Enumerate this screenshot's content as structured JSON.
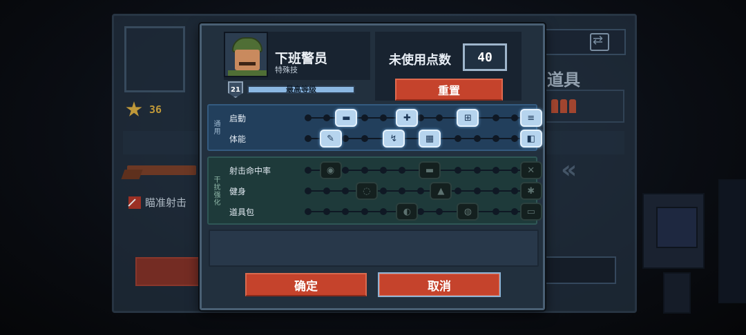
{
  "hero": {
    "name": "下班警员",
    "subtitle": "特殊技",
    "level": "21",
    "level_label": "最高等级"
  },
  "points": {
    "label": "未使用点数",
    "value": "40",
    "reset_label": "重置"
  },
  "groups": [
    {
      "tab": "通用",
      "rows": [
        {
          "label": "启動",
          "nodes": [
            {
              "pos": 0.17,
              "icon": "▬",
              "name": "ammo-clip-icon",
              "state": "active"
            },
            {
              "pos": 0.44,
              "icon": "✚",
              "name": "shield-plus-icon",
              "state": "active"
            },
            {
              "pos": 0.71,
              "icon": "⊞",
              "name": "medkit-icon",
              "state": "active"
            },
            {
              "pos": 0.99,
              "icon": "≡",
              "name": "crate-icon",
              "state": "active"
            }
          ]
        },
        {
          "label": "体能",
          "nodes": [
            {
              "pos": 0.1,
              "icon": "✎",
              "name": "knife-icon",
              "state": "active"
            },
            {
              "pos": 0.38,
              "icon": "↯",
              "name": "sprint-icon",
              "state": "active"
            },
            {
              "pos": 0.54,
              "icon": "▦",
              "name": "armor-icon",
              "state": "active"
            },
            {
              "pos": 0.99,
              "icon": "◧",
              "name": "flask-icon",
              "state": "active"
            }
          ]
        }
      ]
    },
    {
      "tab": "干扰强化",
      "rows": [
        {
          "label": "射击命中率",
          "nodes": [
            {
              "pos": 0.1,
              "icon": "◉",
              "name": "bullet-icon",
              "state": "locked"
            },
            {
              "pos": 0.54,
              "icon": "▬",
              "name": "rifle-icon",
              "state": "locked"
            },
            {
              "pos": 0.99,
              "icon": "✕",
              "name": "crosshair-icon",
              "state": "locked"
            }
          ]
        },
        {
          "label": "健身",
          "nodes": [
            {
              "pos": 0.26,
              "icon": "◌",
              "name": "fist-icon",
              "state": "locked"
            },
            {
              "pos": 0.59,
              "icon": "▲",
              "name": "dash-icon",
              "state": "locked"
            },
            {
              "pos": 0.99,
              "icon": "✱",
              "name": "strength-icon",
              "state": "locked"
            }
          ]
        },
        {
          "label": "道具包",
          "nodes": [
            {
              "pos": 0.44,
              "icon": "◐",
              "name": "bag-icon",
              "state": "locked"
            },
            {
              "pos": 0.71,
              "icon": "◍",
              "name": "grenade-icon",
              "state": "locked"
            },
            {
              "pos": 0.99,
              "icon": "▭",
              "name": "battery-icon",
              "state": "locked"
            }
          ]
        }
      ]
    }
  ],
  "buttons": {
    "confirm": "确定",
    "cancel": "取消"
  },
  "base": {
    "stars": "36",
    "aim_label": "瞄准射击",
    "items_title": "道具"
  },
  "colors": {
    "accent_red": "#c5432c",
    "active_node": "#b6d4ee",
    "panel": "#22303e"
  }
}
